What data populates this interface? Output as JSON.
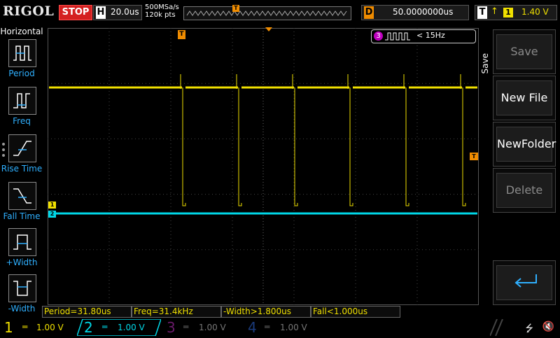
{
  "header": {
    "logo": "RIGOL",
    "run_state": "STOP",
    "h_letter": "H",
    "timebase": "20.0us",
    "sample_rate": "500MSa/s",
    "memory_depth": "120k pts",
    "d_letter": "D",
    "delay": "50.0000000us",
    "t_letter": "T",
    "trigger_source": "1",
    "trigger_level": "1.40 V",
    "trigger_marker": "T"
  },
  "left_panel": {
    "title": "Horizontal",
    "items": [
      {
        "label": "Period",
        "icon": "period-icon"
      },
      {
        "label": "Freq",
        "icon": "freq-icon"
      },
      {
        "label": "Rise Time",
        "icon": "rise-time-icon"
      },
      {
        "label": "Fall Time",
        "icon": "fall-time-icon"
      },
      {
        "label": "+Width",
        "icon": "pos-width-icon"
      },
      {
        "label": "-Width",
        "icon": "neg-width-icon"
      }
    ]
  },
  "screen": {
    "freq_badge_channel": "3",
    "freq_badge_text": "< 15Hz",
    "ch1_marker": "1",
    "ch2_marker": "2",
    "trigger_level_marker": "T",
    "trigger_pos_marker": "T"
  },
  "right_panel": {
    "title": "Save",
    "buttons": [
      {
        "label": "Save",
        "enabled": false
      },
      {
        "label": "New File",
        "enabled": true
      },
      {
        "label": "NewFolder",
        "enabled": true
      },
      {
        "label": "Delete",
        "enabled": false
      },
      {
        "label": "",
        "enabled": true,
        "icon": "back-arrow-icon"
      }
    ]
  },
  "measurements": [
    {
      "text": "Period=31.80us"
    },
    {
      "text": "Freq=31.4kHz"
    },
    {
      "text": "-Width>1.800us"
    },
    {
      "text": "Fall<1.000us"
    }
  ],
  "channels": [
    {
      "num": "1",
      "scale": "1.00 V",
      "color": "#f0e000",
      "active": true
    },
    {
      "num": "2",
      "scale": "1.00 V",
      "color": "#00d8e8",
      "active": true
    },
    {
      "num": "3",
      "scale": "1.00 V",
      "color": "#c000c0",
      "active": false
    },
    {
      "num": "4",
      "scale": "1.00 V",
      "color": "#2060ff",
      "active": false
    }
  ],
  "colors": {
    "ch1": "#f0e000",
    "ch2": "#00d8e8",
    "trigger": "#f08c00",
    "label_blue": "#2fb0ff"
  }
}
